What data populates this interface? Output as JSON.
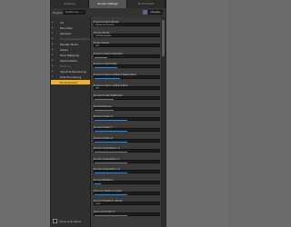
{
  "tabs": [
    {
      "label": "Surfaces",
      "active": false
    },
    {
      "label": "Render Settings",
      "active": true
    },
    {
      "label": "Environment",
      "active": false
    }
  ],
  "toolbar": {
    "filter_label": "Engine",
    "filter_value": "NVIDIA Iray",
    "button_label": "Presets"
  },
  "tree": {
    "items": [
      {
        "label": "All",
        "selected": false,
        "dim": false
      },
      {
        "label": "Favorites",
        "selected": false,
        "dim": false
      },
      {
        "label": "General",
        "selected": false,
        "dim": false
      },
      {
        "label": "Progressive Rendering",
        "selected": false,
        "dim": true
      },
      {
        "label": "Render Mode",
        "selected": false,
        "dim": false
      },
      {
        "label": "Alpha",
        "selected": false,
        "dim": false
      },
      {
        "label": "Tone Mapping",
        "selected": false,
        "dim": false
      },
      {
        "label": "Optimization",
        "selected": false,
        "dim": false
      },
      {
        "label": "Filtering",
        "selected": false,
        "dim": true
      },
      {
        "label": "Spectral Rendering",
        "selected": false,
        "dim": false
      },
      {
        "label": "Post Processing",
        "selected": false,
        "dim": false
      },
      {
        "label": "Environment",
        "selected": true,
        "dim": false
      }
    ],
    "show_sub_items": "Show Sub Items"
  },
  "properties": [
    {
      "label": "Environment Mode",
      "value": "Dome and Scene",
      "slider": 0
    },
    {
      "label": "Dome Mode",
      "value": "Infinite Sphere",
      "slider": 0
    },
    {
      "label": "Draw Dome",
      "value": "Off",
      "slider": 0
    },
    {
      "label": "Environment Intensity",
      "value": "",
      "slider": 0.2
    },
    {
      "label": "Environment Map",
      "value": "",
      "slider": 0.35
    },
    {
      "label": "Environment Lighting Resolution",
      "value": "",
      "slider": 0.4
    },
    {
      "label": "Environment Lighting Blur",
      "value": "Off",
      "slider": 0
    },
    {
      "label": "Dome Scale Multiplier",
      "value": "",
      "slider": 0.3
    },
    {
      "label": "Dome Radius",
      "value": "",
      "slider": 0.3
    },
    {
      "label": "Dome Origin X",
      "value": "",
      "slider": 0.5
    },
    {
      "label": "Dome Origin Y",
      "value": "",
      "slider": 0.5
    },
    {
      "label": "Dome Origin Z",
      "value": "",
      "slider": 0.5
    },
    {
      "label": "Dome Orientation X",
      "value": "",
      "slider": 0.5
    },
    {
      "label": "Dome Orientation Y",
      "value": "",
      "slider": 0.5
    },
    {
      "label": "Dome Orientation Z",
      "value": "",
      "slider": 0.5
    },
    {
      "label": "Dome Rotation",
      "value": "",
      "slider": 0.1
    },
    {
      "label": "Ground Texture Scale",
      "value": "",
      "slider": 0.5
    },
    {
      "label": "Ground Position Mode",
      "value": "Auto",
      "slider": 0
    },
    {
      "label": "Ground Origin X",
      "value": "",
      "slider": 0.5
    }
  ]
}
